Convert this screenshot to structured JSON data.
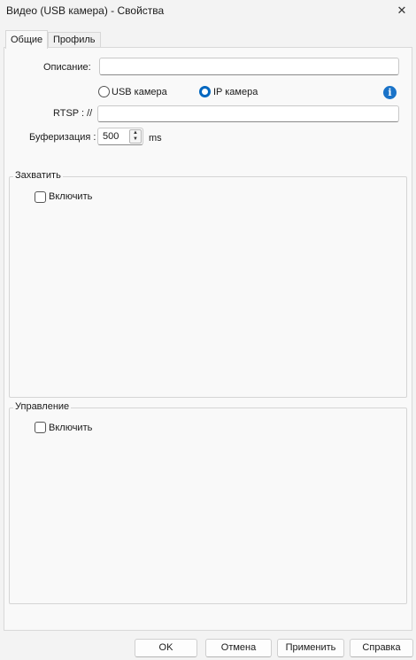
{
  "window": {
    "title": "Видео (USB камера) - Свойства",
    "close_glyph": "✕"
  },
  "tabs": [
    {
      "label": "Общие",
      "active": true
    },
    {
      "label": "Профиль",
      "active": false
    }
  ],
  "general": {
    "description_label": "Описание:",
    "description_value": "",
    "source_options": [
      {
        "label": "USB камера",
        "checked": false
      },
      {
        "label": "IP камера",
        "checked": true
      }
    ],
    "info_glyph": "i",
    "rtsp_label": "RTSP : //",
    "rtsp_value": "",
    "buffering_label": "Буферизация :",
    "buffering_value": "500",
    "buffering_unit": "ms"
  },
  "capture_group": {
    "title": "Захватить",
    "enable_label": "Включить",
    "enabled": false
  },
  "control_group": {
    "title": "Управление",
    "enable_label": "Включить",
    "enabled": false
  },
  "buttons": {
    "ok": "OK",
    "cancel": "Отмена",
    "apply": "Применить",
    "help": "Справка"
  },
  "colors": {
    "accent": "#0067c0",
    "info": "#1a73c8"
  }
}
